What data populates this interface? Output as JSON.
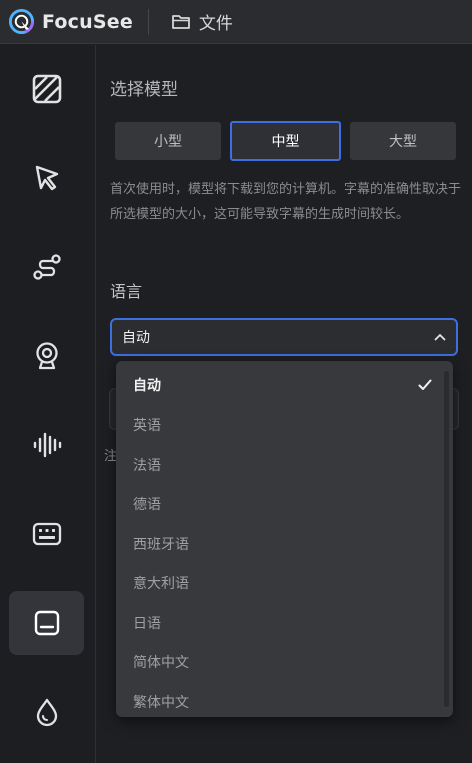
{
  "app": {
    "name": "FocuSee",
    "file_menu": "文件"
  },
  "sidebar": {
    "items": [
      {
        "icon": "pattern-icon"
      },
      {
        "icon": "cursor-icon"
      },
      {
        "icon": "path-icon"
      },
      {
        "icon": "webcam-icon"
      },
      {
        "icon": "audio-wave-icon"
      },
      {
        "icon": "keyboard-icon"
      },
      {
        "icon": "captions-icon",
        "active": true
      },
      {
        "icon": "drop-icon"
      }
    ]
  },
  "panel": {
    "model_title": "选择模型",
    "models": [
      "小型",
      "中型",
      "大型"
    ],
    "selected_model": "中型",
    "description": "首次使用时，模型将下载到您的计算机。字幕的准确性取决于所选模型的大小，这可能导致字幕的生成时间较长。",
    "language_label": "语言",
    "language_value": "自动",
    "behind_text": "注"
  },
  "dropdown": {
    "options": [
      "自动",
      "英语",
      "法语",
      "德语",
      "西班牙语",
      "意大利语",
      "日语",
      "简体中文",
      "繁体中文"
    ],
    "selected": "自动"
  },
  "colors": {
    "accent": "#3e6fe0",
    "background": "#1e1f22",
    "sidebar_active": "#33353a"
  }
}
